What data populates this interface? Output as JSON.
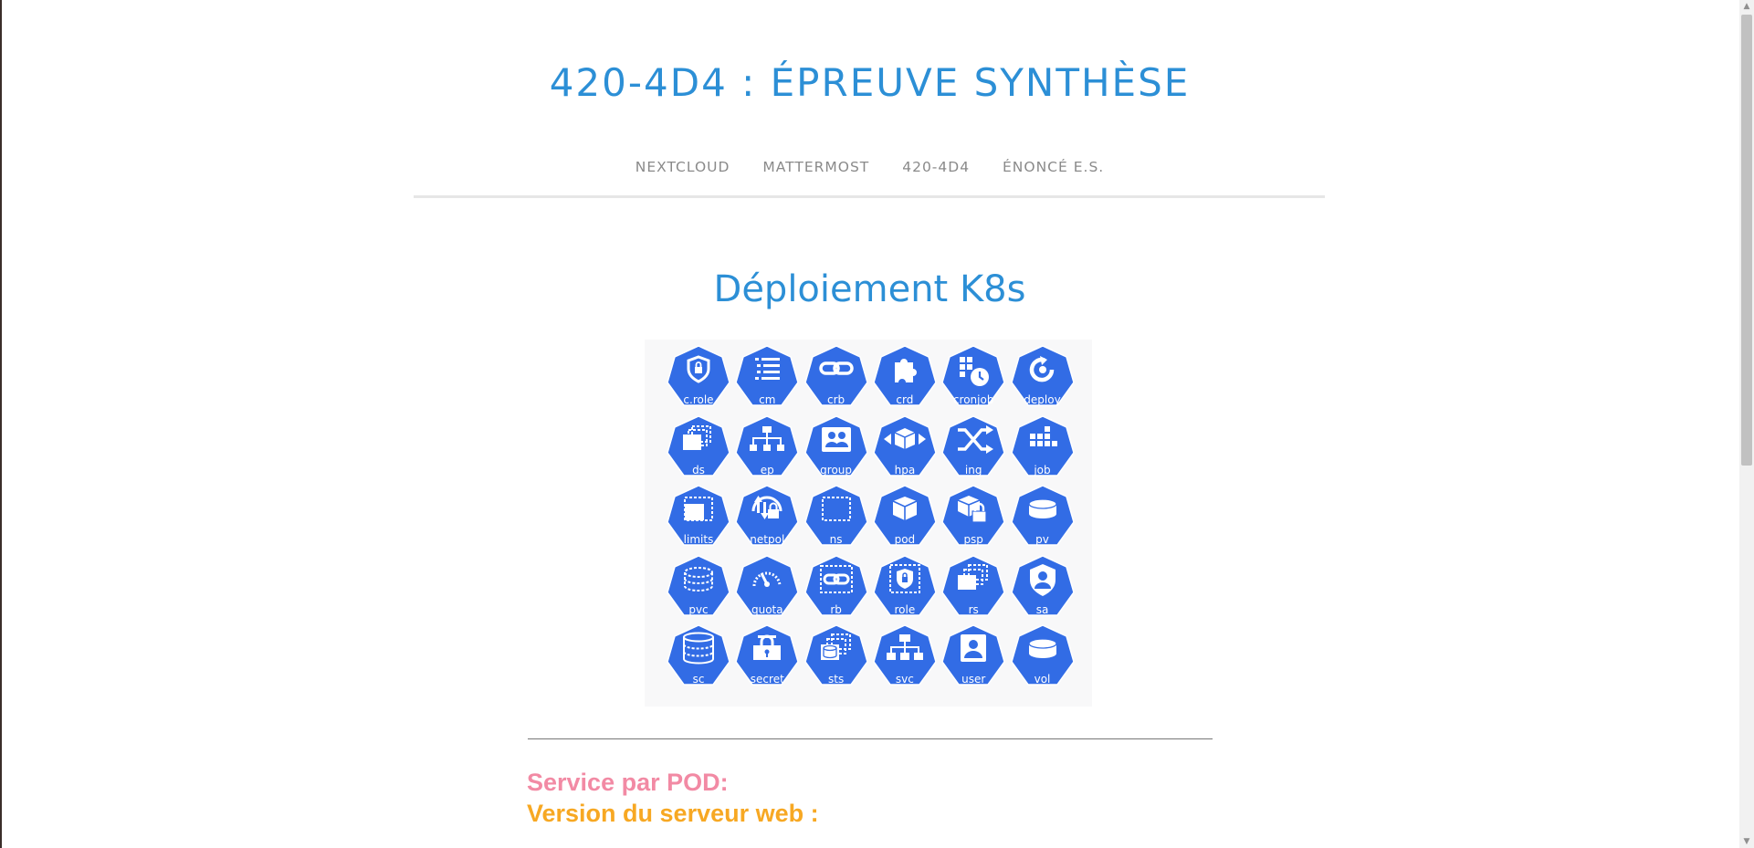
{
  "site": {
    "title": "420-4D4 : ÉPREUVE SYNTHÈSE"
  },
  "nav": {
    "items": [
      {
        "label": "NEXTCLOUD"
      },
      {
        "label": "MATTERMOST"
      },
      {
        "label": "420-4D4"
      },
      {
        "label": "ÉNONCÉ E.S."
      }
    ]
  },
  "main": {
    "heading": "Déploiement K8s",
    "service_label": "Service par POD:",
    "version_label": "Version du serveur web :"
  },
  "colors": {
    "accent_blue": "#2c8fd6",
    "icon_blue": "#326ce5",
    "service_pink": "#f28aa4",
    "version_orange": "#f7a823"
  },
  "k8s_icons": [
    {
      "label": "c.role",
      "icon": "cluster-role-icon"
    },
    {
      "label": "cm",
      "icon": "config-map-icon"
    },
    {
      "label": "crb",
      "icon": "cluster-role-binding-icon"
    },
    {
      "label": "crd",
      "icon": "custom-resource-definition-icon"
    },
    {
      "label": "cronjob",
      "icon": "cronjob-icon"
    },
    {
      "label": "deploy",
      "icon": "deployment-icon"
    },
    {
      "label": "ds",
      "icon": "daemon-set-icon"
    },
    {
      "label": "ep",
      "icon": "endpoints-icon"
    },
    {
      "label": "group",
      "icon": "group-icon"
    },
    {
      "label": "hpa",
      "icon": "horizontal-pod-autoscaler-icon"
    },
    {
      "label": "ing",
      "icon": "ingress-icon"
    },
    {
      "label": "job",
      "icon": "job-icon"
    },
    {
      "label": "limits",
      "icon": "limit-range-icon"
    },
    {
      "label": "netpol",
      "icon": "network-policy-icon"
    },
    {
      "label": "ns",
      "icon": "namespace-icon"
    },
    {
      "label": "pod",
      "icon": "pod-icon"
    },
    {
      "label": "psp",
      "icon": "pod-security-policy-icon"
    },
    {
      "label": "pv",
      "icon": "persistent-volume-icon"
    },
    {
      "label": "pvc",
      "icon": "persistent-volume-claim-icon"
    },
    {
      "label": "quota",
      "icon": "resource-quota-icon"
    },
    {
      "label": "rb",
      "icon": "role-binding-icon"
    },
    {
      "label": "role",
      "icon": "role-icon"
    },
    {
      "label": "rs",
      "icon": "replica-set-icon"
    },
    {
      "label": "sa",
      "icon": "service-account-icon"
    },
    {
      "label": "sc",
      "icon": "storage-class-icon"
    },
    {
      "label": "secret",
      "icon": "secret-icon"
    },
    {
      "label": "sts",
      "icon": "stateful-set-icon"
    },
    {
      "label": "svc",
      "icon": "service-icon"
    },
    {
      "label": "user",
      "icon": "user-icon"
    },
    {
      "label": "vol",
      "icon": "volume-icon"
    }
  ]
}
